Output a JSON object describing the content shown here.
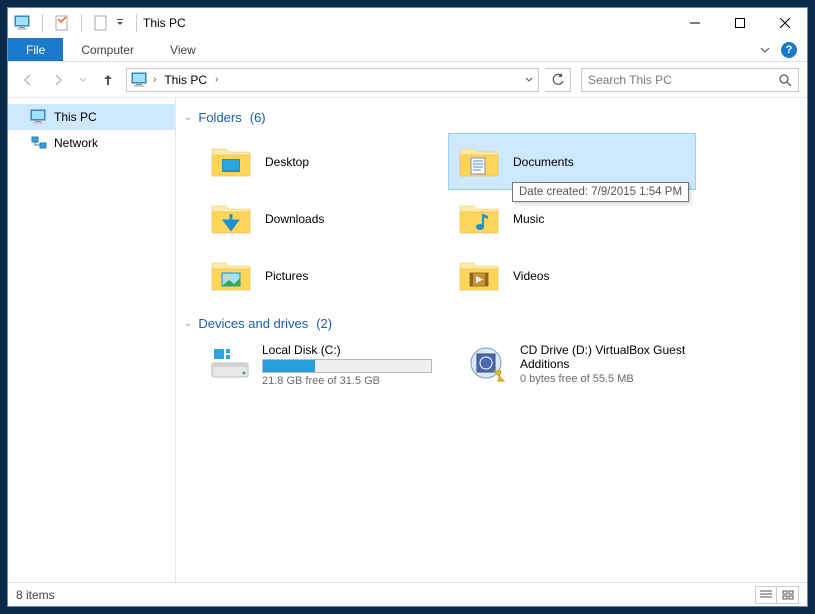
{
  "title": "This PC",
  "ribbon": {
    "file": "File",
    "tabs": [
      "Computer",
      "View"
    ]
  },
  "addressbar": {
    "crumb": "This PC"
  },
  "search": {
    "placeholder": "Search This PC"
  },
  "navpane": {
    "items": [
      {
        "label": "This PC",
        "selected": true
      },
      {
        "label": "Network",
        "selected": false
      }
    ]
  },
  "groups": {
    "folders": {
      "title": "Folders",
      "count": "(6)",
      "items": [
        {
          "label": "Desktop"
        },
        {
          "label": "Documents",
          "selected": true
        },
        {
          "label": "Downloads"
        },
        {
          "label": "Music"
        },
        {
          "label": "Pictures"
        },
        {
          "label": "Videos"
        }
      ]
    },
    "drives": {
      "title": "Devices and drives",
      "count": "(2)",
      "items": [
        {
          "name": "Local Disk (C:)",
          "free": "21.8 GB free of 31.5 GB",
          "fillPercent": 31
        },
        {
          "name": "CD Drive (D:) VirtualBox Guest Additions",
          "free": "0 bytes free of 55.5 MB"
        }
      ]
    }
  },
  "tooltip": "Date created: 7/9/2015 1:54 PM",
  "statusbar": {
    "items": "8 items"
  }
}
